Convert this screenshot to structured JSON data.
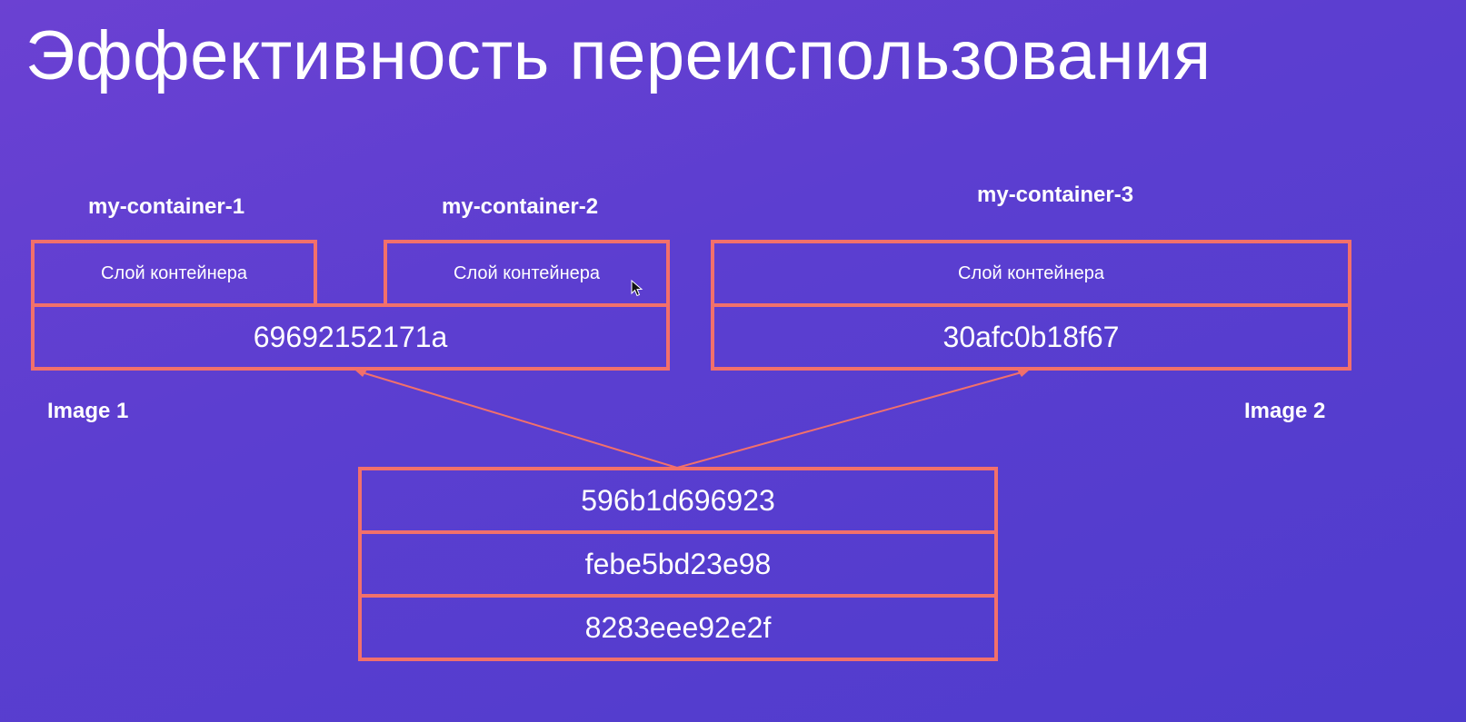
{
  "slide": {
    "title": "Эффективность переиспользования"
  },
  "containers": [
    {
      "name": "my-container-1",
      "layer_label": "Слой контейнера"
    },
    {
      "name": "my-container-2",
      "layer_label": "Слой контейнера"
    },
    {
      "name": "my-container-3",
      "layer_label": "Слой контейнера"
    }
  ],
  "images": [
    {
      "label": "Image 1",
      "top_layer": "69692152171a"
    },
    {
      "label": "Image 2",
      "top_layer": "30afc0b18f67"
    }
  ],
  "shared_layers": [
    "596b1d696923",
    "febe5bd23e98",
    "8283eee92e2f"
  ],
  "colors": {
    "accent": "#f2706b",
    "background": "#5c3ed0",
    "text": "#ffffff"
  }
}
